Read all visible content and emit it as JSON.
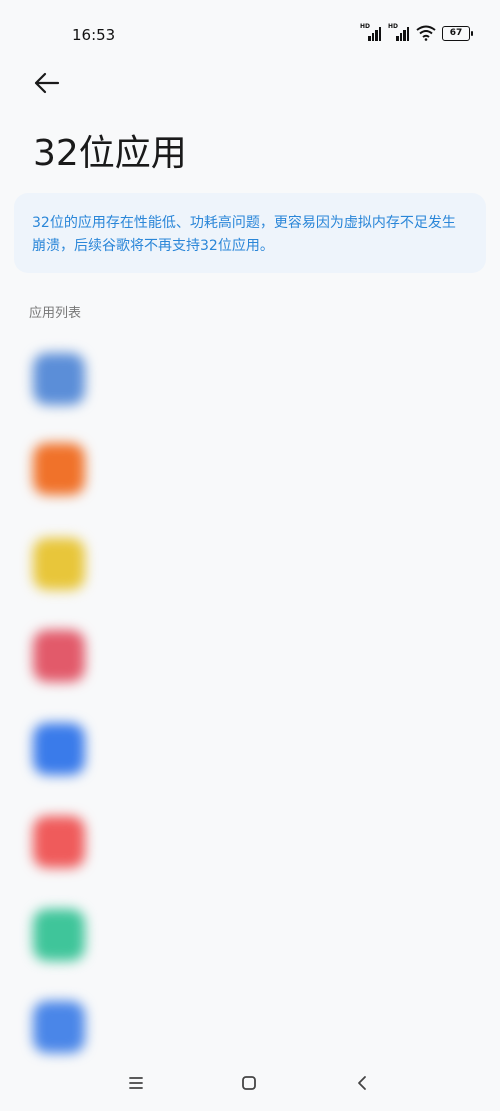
{
  "status_bar": {
    "time": "16:53",
    "signal_label_1": "HD",
    "signal_label_2": "HD",
    "battery": "67"
  },
  "header": {
    "back_icon": "arrow-left-icon",
    "title": "32位应用"
  },
  "notice": {
    "text": "32位的应用存在性能低、功耗高问题，更容易因为虚拟内存不足发生崩溃，后续谷歌将不再支持32位应用。",
    "color": "#2a86d8",
    "background": "#eef4fb"
  },
  "section": {
    "header": "应用列表"
  },
  "apps": [
    {
      "name": "",
      "icon_color": "#5b8ed8"
    },
    {
      "name": "",
      "icon_color": "#f0722a"
    },
    {
      "name": "",
      "icon_color": "#e8c63a"
    },
    {
      "name": "",
      "icon_color": "#e25a6a"
    },
    {
      "name": "",
      "icon_color": "#3a7bea"
    },
    {
      "name": "",
      "icon_color": "#ef5b5b"
    },
    {
      "name": "",
      "icon_color": "#3fc59a"
    },
    {
      "name": "",
      "icon_color": "#4a86e8"
    }
  ],
  "nav": {
    "menu_icon": "menu-icon",
    "home_icon": "home-square-icon",
    "back_icon": "back-chevron-icon"
  }
}
